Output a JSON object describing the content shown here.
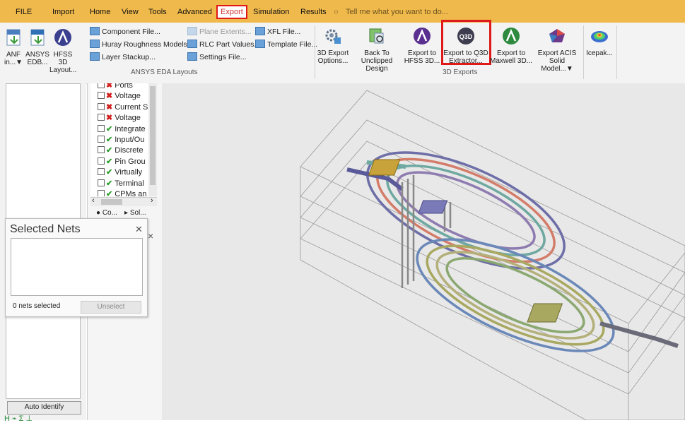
{
  "menu": {
    "items": [
      "FILE",
      "Import",
      "Home",
      "View",
      "Tools",
      "Advanced",
      "Export",
      "Simulation",
      "Results"
    ],
    "active": "Export",
    "search_placeholder": "Tell me what you want to do..."
  },
  "ribbon": {
    "eda_group_label": "ANSYS EDA Layouts",
    "exports_group_label": "3D Exports",
    "anf": "ANF in...▼",
    "ansys_edb": "ANSYS EDB...",
    "hfss_3d_layout": "HFSS 3D Layout...",
    "component_file": "Component File...",
    "huray": "Huray Roughness Models...",
    "layer_stackup": "Layer Stackup...",
    "plane_extents": "Plane Extents...",
    "rlc_part": "RLC Part Values...",
    "settings_file": "Settings File...",
    "xfl_file": "XFL File...",
    "template_file": "Template File...",
    "export_options": "3D Export Options...",
    "back_unclipped": "Back To Unclipped Design",
    "export_hfss3d": "Export to HFSS 3D...",
    "export_q3d": "Export to Q3D Extractor...",
    "export_maxwell": "Export to Maxwell 3D...",
    "export_acis": "Export ACIS Solid Model...▼",
    "icepak": "Icepak..."
  },
  "tree": {
    "items": [
      {
        "label": "Ports",
        "state": "x"
      },
      {
        "label": "Voltage",
        "state": "x"
      },
      {
        "label": "Current S",
        "state": "x"
      },
      {
        "label": "Voltage",
        "state": "x"
      },
      {
        "label": "Integrate",
        "state": "check"
      },
      {
        "label": "Input/Ou",
        "state": "check"
      },
      {
        "label": "Discrete",
        "state": "check"
      },
      {
        "label": "Pin Grou",
        "state": "check"
      },
      {
        "label": "Virtually",
        "state": "check"
      },
      {
        "label": "Terminal",
        "state": "check"
      },
      {
        "label": "CPMs an",
        "state": "check"
      }
    ],
    "tab_co": "Co...",
    "tab_sol": "Sol..."
  },
  "nets_dialog": {
    "title": "Selected Nets",
    "count": "0 nets selected",
    "unselect": "Unselect"
  },
  "left_panel": {
    "auto_identify": "Auto Identify"
  },
  "colors": {
    "menubar": "#f0b94c",
    "highlight": "#e01919"
  }
}
